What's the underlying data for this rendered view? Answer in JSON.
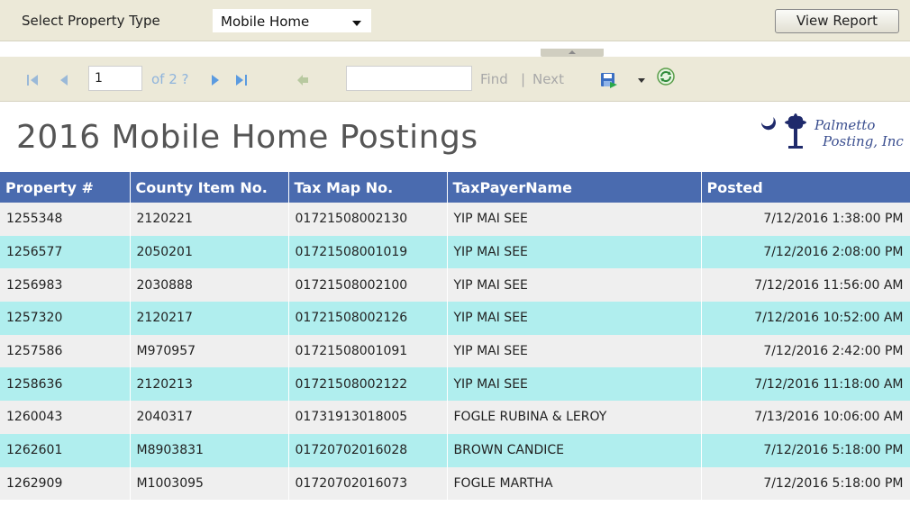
{
  "params": {
    "property_type_label": "Select Property Type",
    "property_type_value": "Mobile Home",
    "view_report_label": "View Report"
  },
  "toolbar": {
    "page_number": "1",
    "page_of": "of 2 ?",
    "find_label": "Find",
    "separator": "|",
    "next_label": "Next"
  },
  "report": {
    "title": "2016 Mobile Home Postings",
    "logo_line1": "Palmetto",
    "logo_line2": "Posting, Inc"
  },
  "table": {
    "columns": [
      "Property #",
      "County Item No.",
      "Tax Map No.",
      "TaxPayerName",
      "Posted"
    ],
    "rows": [
      [
        "1255348",
        "2120221",
        "01721508002130",
        "YIP MAI SEE",
        "7/12/2016 1:38:00 PM"
      ],
      [
        "1256577",
        "2050201",
        "01721508001019",
        "YIP MAI SEE",
        "7/12/2016 2:08:00 PM"
      ],
      [
        "1256983",
        "2030888",
        "01721508002100",
        "YIP MAI SEE",
        "7/12/2016 11:56:00 AM"
      ],
      [
        "1257320",
        "2120217",
        "01721508002126",
        "YIP MAI SEE",
        "7/12/2016 10:52:00 AM"
      ],
      [
        "1257586",
        "M970957",
        "01721508001091",
        "YIP MAI SEE",
        "7/12/2016 2:42:00 PM"
      ],
      [
        "1258636",
        "2120213",
        "01721508002122",
        "YIP MAI SEE",
        "7/12/2016 11:18:00 AM"
      ],
      [
        "1260043",
        "2040317",
        "01731913018005",
        "FOGLE RUBINA & LEROY",
        "7/13/2016 10:06:00 AM"
      ],
      [
        "1262601",
        "M8903831",
        "01720702016028",
        "BROWN CANDICE",
        "7/12/2016 5:18:00 PM"
      ],
      [
        "1262909",
        "M1003095",
        "01720702016073",
        "FOGLE MARTHA",
        "7/12/2016 5:18:00 PM"
      ]
    ]
  },
  "colors": {
    "header_bg": "#4a6baf",
    "row_alt": "#b0eeee",
    "row_base": "#efefef",
    "toolbar_bg": "#ece9d8"
  },
  "icons": [
    "first-page-icon",
    "prev-page-icon",
    "next-page-icon",
    "last-page-icon",
    "back-icon",
    "save-icon",
    "dropdown-icon",
    "refresh-icon",
    "palmetto-logo"
  ]
}
